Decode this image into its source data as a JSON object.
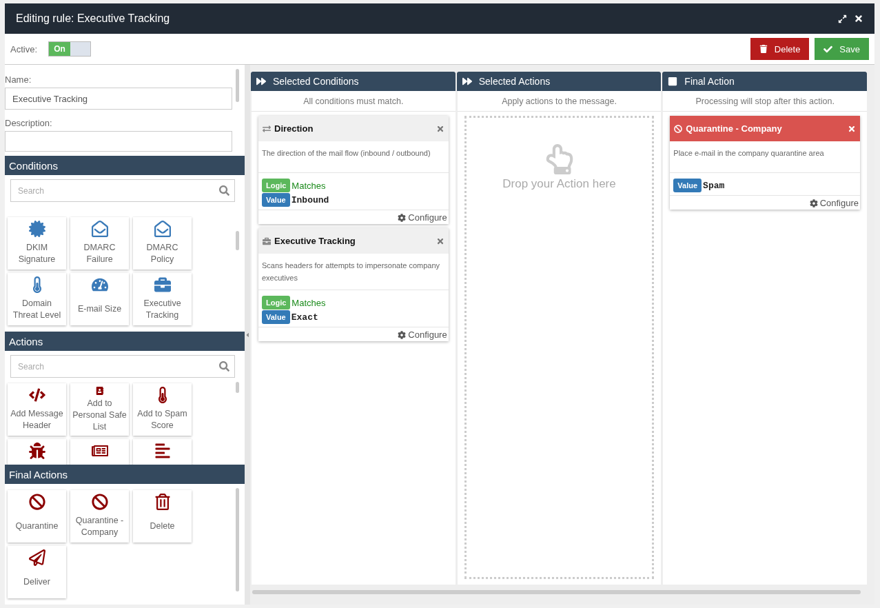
{
  "window": {
    "title": "Editing rule: Executive Tracking"
  },
  "toolbar": {
    "active_label": "Active:",
    "toggle": {
      "on": true,
      "label": "On"
    },
    "buttons": [
      {
        "kind": "delete",
        "label": "Delete"
      },
      {
        "kind": "save",
        "label": "Save"
      }
    ]
  },
  "form": {
    "name_label": "Name:",
    "name_value": "Executive Tracking",
    "description_label": "Description:"
  },
  "palette": [
    {
      "kind": "condition",
      "title": "Conditions",
      "search_placeholder": "Search",
      "tiles": [
        {
          "kind": "labeled",
          "label": "DKIM Signature"
        },
        {
          "kind": "labeled",
          "label": "DMARC Failure"
        },
        {
          "kind": "labeled",
          "label": "DMARC Policy"
        },
        {
          "kind": "labeled",
          "label": "Domain Threat Level"
        },
        {
          "kind": "labeled",
          "label": "E-mail Size"
        },
        {
          "kind": "labeled",
          "label": "Executive Tracking"
        }
      ]
    },
    {
      "kind": "action",
      "title": "Actions",
      "search_placeholder": "Search",
      "tiles": [
        {
          "kind": "labeled",
          "label": "Add Message Header"
        },
        {
          "kind": "labeled",
          "label": "Add to Personal Safe List"
        },
        {
          "kind": "labeled",
          "label": "Add to Spam Score"
        },
        {
          "kind": "clipped"
        },
        {
          "kind": "clipped"
        },
        {
          "kind": "clipped"
        }
      ]
    },
    {
      "kind": "final",
      "title": "Final Actions",
      "tiles": [
        {
          "kind": "labeled",
          "label": "Quarantine"
        },
        {
          "kind": "labeled",
          "label": "Quarantine - Company"
        },
        {
          "kind": "labeled",
          "label": "Delete"
        },
        {
          "kind": "labeled",
          "label": "Deliver"
        }
      ]
    }
  ],
  "columns": [
    {
      "kind": "conditions",
      "title": "Selected Conditions",
      "subtitle": "All conditions must match.",
      "cards": [
        {
          "kind": "condition",
          "title": "Direction",
          "description": "The direction of the mail flow (inbound / outbound)",
          "rows": [
            {
              "kind": "logic",
              "badge": "Logic",
              "value": "Matches"
            },
            {
              "kind": "value",
              "badge": "Value",
              "value": "Inbound"
            }
          ],
          "configure": "Configure"
        },
        {
          "kind": "condition",
          "title": "Executive Tracking",
          "description": "Scans headers for attempts to impersonate company executives",
          "rows": [
            {
              "kind": "logic",
              "badge": "Logic",
              "value": "Matches"
            },
            {
              "kind": "value",
              "badge": "Value",
              "value": "Exact"
            }
          ],
          "configure": "Configure"
        }
      ]
    },
    {
      "kind": "actions",
      "title": "Selected Actions",
      "subtitle": "Apply actions to the message.",
      "dropzone": {
        "text": "Drop your Action here"
      }
    },
    {
      "kind": "final",
      "title": "Final Action",
      "subtitle": "Processing will stop after this action.",
      "cards": [
        {
          "kind": "final",
          "title": "Quarantine - Company",
          "description": "Place e-mail in the company quarantine area",
          "rows": [
            {
              "kind": "value",
              "badge": "Value",
              "value": "Spam"
            }
          ],
          "configure": "Configure"
        }
      ]
    }
  ]
}
